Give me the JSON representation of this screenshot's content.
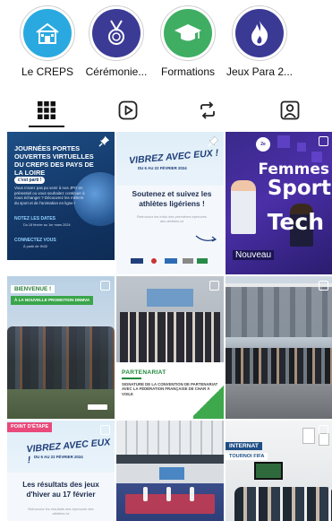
{
  "highlights": [
    {
      "label": "Le CREPS",
      "icon": "school-building-icon",
      "color": "#29a9e0"
    },
    {
      "label": "Cérémonie...",
      "icon": "medal-icon",
      "color": "#3b3b96"
    },
    {
      "label": "Formations",
      "icon": "graduation-cap-icon",
      "color": "#3fae63"
    },
    {
      "label": "Jeux Para 2...",
      "icon": "flame-icon",
      "color": "#3a3a95"
    }
  ],
  "tabs": [
    {
      "name": "posts-grid-tab",
      "icon": "grid-icon",
      "active": true
    },
    {
      "name": "reels-tab",
      "icon": "play-square-icon",
      "active": false
    },
    {
      "name": "reposts-tab",
      "icon": "repost-icon",
      "active": false
    },
    {
      "name": "tagged-tab",
      "icon": "person-tag-icon",
      "active": false
    }
  ],
  "posts": {
    "p1": {
      "title": "Journées portes ouvertes virtuelles du CREPS des Pays de la Loire",
      "pill": "c'est parti !",
      "body": "Vous n'avez pas pu venir à nos JPO en présentiel ou vous souhaitez continuer à nous échanger ? Découvrez les métiers du sport et de l'animation en ligne !",
      "section1": "NOTEZ LES DATES",
      "section1_text": "Du 18 février au 1er mars 2024",
      "section2": "CONNECTEZ VOUS",
      "section2_text": "À partir de 9h30"
    },
    "p2": {
      "headline": "VIBREZ AVEC EUX !",
      "date": "DU 6 AU 22 FÉVRIER 2024",
      "title": "Soutenez et suivez les athlètes ligériens !",
      "desc": "Retrouvez les infos des premières épreuves des athlètes ici"
    },
    "p3": {
      "line1": "Femmes",
      "line2": "Sport",
      "line3": "Tech",
      "badge": "Nouveau",
      "year": "2e"
    },
    "p4": {
      "tag": "BIENVENUE !",
      "sub": "À LA NOUVELLE PROMOTION DNMVA"
    },
    "p5": {
      "tag": "PARTENARIAT",
      "text": "SIGNATURE DE LA CONVENTION DE PARTENARIAT AVEC LA FÉDÉRATION FRANÇAISE DE CHAR À VOILE"
    },
    "p7": {
      "tag": "POINT D'ÉTAPE",
      "headline": "VIBREZ AVEC EUX !",
      "date": "DU 6 AU 22 FÉVRIER 2024",
      "title": "Les résultats des jeux d'hiver au 17 février",
      "desc": "Retrouvez les résultats des épreuves des athlètes ici"
    },
    "p9": {
      "tag1": "INTERNAT",
      "tag2": "TOURNOI FIFA"
    }
  }
}
